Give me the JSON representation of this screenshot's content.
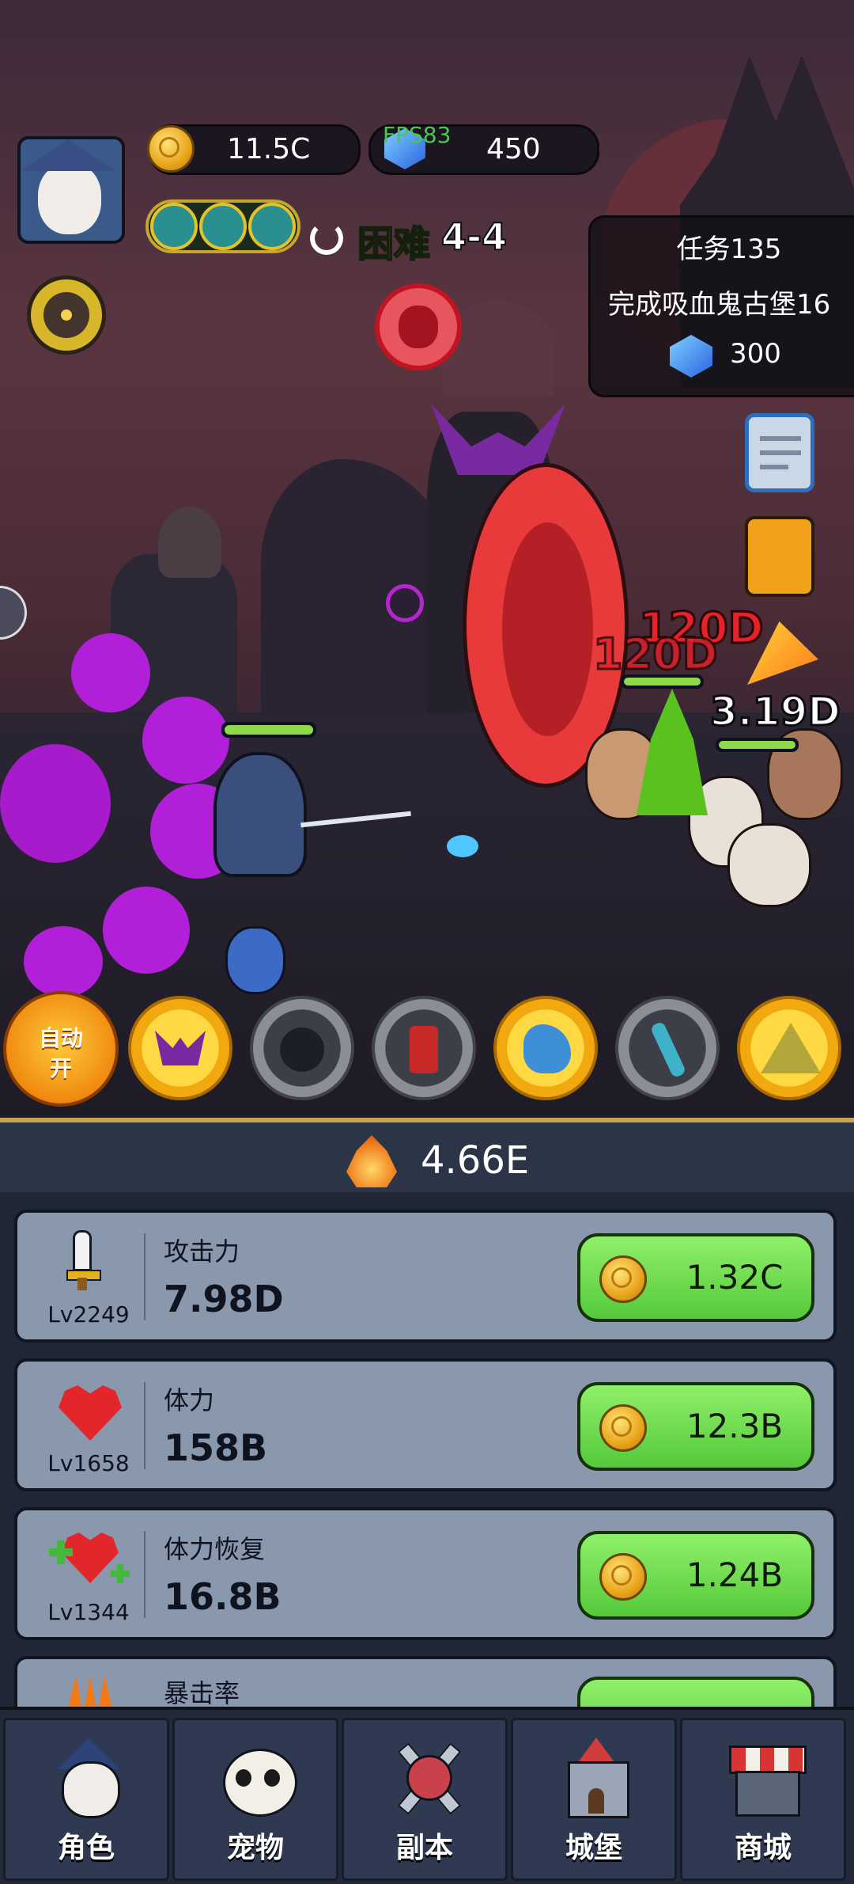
{
  "hud": {
    "gold": "11.5C",
    "fps_overlay": "FPS83",
    "gems": "450",
    "difficulty": "困难",
    "stage": "4-4"
  },
  "quest": {
    "title": "任务135",
    "description": "完成吸血鬼古堡16",
    "reward": "300"
  },
  "battle": {
    "damage_numbers": [
      "120D",
      "120D"
    ],
    "enemy_hp": "3.19D"
  },
  "skills": {
    "auto_label_top": "自动",
    "auto_label_bottom": "开",
    "icons": [
      "bat-demon-skill",
      "bomb-skill",
      "dynamite-skill",
      "dragon-skill",
      "blade-skill",
      "mountain-skill"
    ]
  },
  "dps": "4.66E",
  "upgrades": [
    {
      "icon": "sword-icon",
      "level": "Lv2249",
      "name": "攻击力",
      "value": "7.98D",
      "cost": "1.32C"
    },
    {
      "icon": "heart-icon",
      "level": "Lv1658",
      "name": "体力",
      "value": "158B",
      "cost": "12.3B"
    },
    {
      "icon": "heart-plus-icon",
      "level": "Lv1344",
      "name": "体力恢复",
      "value": "16.8B",
      "cost": "1.24B"
    },
    {
      "icon": "claw-icon",
      "name": "暴击率"
    }
  ],
  "nav": [
    {
      "label": "角色",
      "icon": "character-icon"
    },
    {
      "label": "宠物",
      "icon": "panda-icon"
    },
    {
      "label": "副本",
      "icon": "crossed-swords-icon"
    },
    {
      "label": "城堡",
      "icon": "castle-icon"
    },
    {
      "label": "商城",
      "icon": "shop-icon"
    }
  ],
  "colors": {
    "accent_gold": "#e9a51b",
    "buy_green": "#55c93a",
    "damage_red": "#e8202a"
  }
}
